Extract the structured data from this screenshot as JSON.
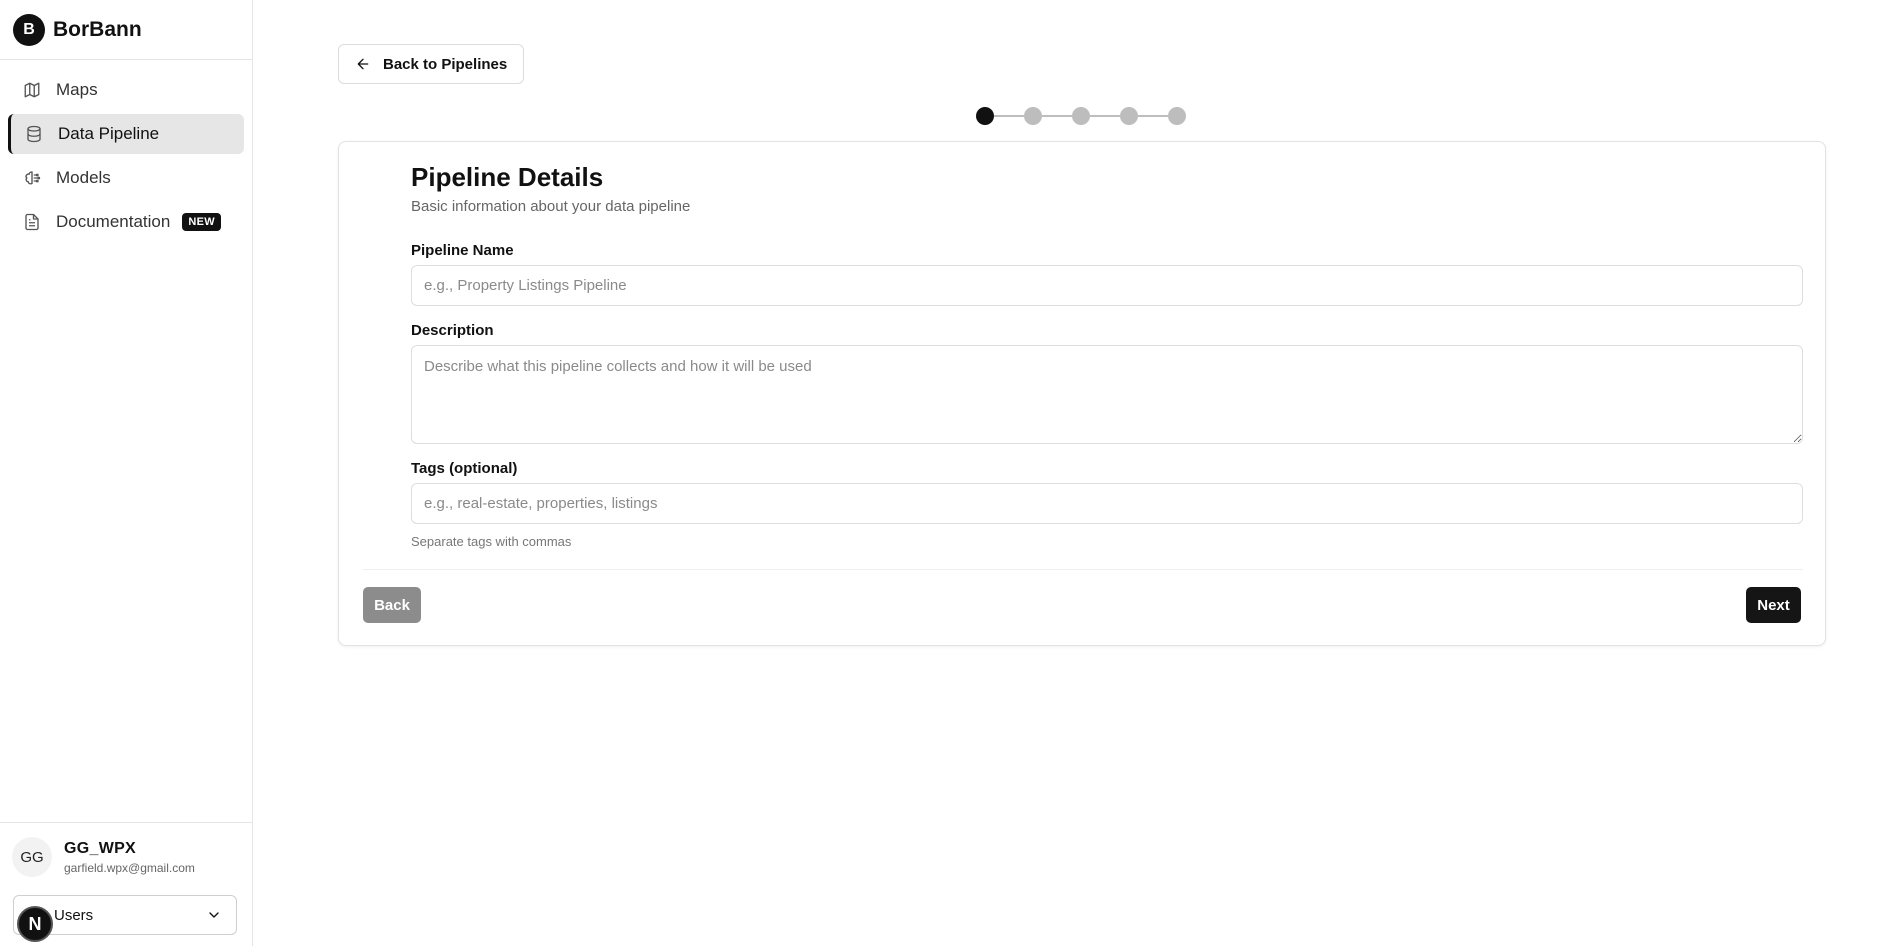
{
  "brand": {
    "logo_letter": "B",
    "name": "BorBann"
  },
  "sidebar": {
    "items": [
      {
        "label": "Maps",
        "icon": "map-icon",
        "active": false
      },
      {
        "label": "Data Pipeline",
        "icon": "database-icon",
        "active": true
      },
      {
        "label": "Models",
        "icon": "brain-icon",
        "active": false
      },
      {
        "label": "Documentation",
        "icon": "document-icon",
        "active": false,
        "badge": "NEW"
      }
    ]
  },
  "user": {
    "initials": "GG",
    "name": "GG_WPX",
    "email": "garfield.wpx@gmail.com",
    "role_selected": "Users",
    "dev_badge": "N"
  },
  "main": {
    "back_link_label": "Back to Pipelines",
    "stepper": {
      "total_steps": 5,
      "current_step": 1
    },
    "form": {
      "title": "Pipeline Details",
      "subtitle": "Basic information about your data pipeline",
      "pipeline_name_label": "Pipeline Name",
      "pipeline_name_placeholder": "e.g., Property Listings Pipeline",
      "pipeline_name_value": "",
      "description_label": "Description",
      "description_placeholder": "Describe what this pipeline collects and how it will be used",
      "description_value": "",
      "tags_label": "Tags (optional)",
      "tags_placeholder": "e.g., real-estate, properties, listings",
      "tags_value": "",
      "tags_helper": "Separate tags with commas",
      "back_button": "Back",
      "next_button": "Next"
    }
  },
  "colors": {
    "accent": "#111111",
    "active_nav_bg": "#e6e6e6",
    "disabled_button": "#8c8c8c",
    "inactive_step": "#bdbdbd"
  }
}
